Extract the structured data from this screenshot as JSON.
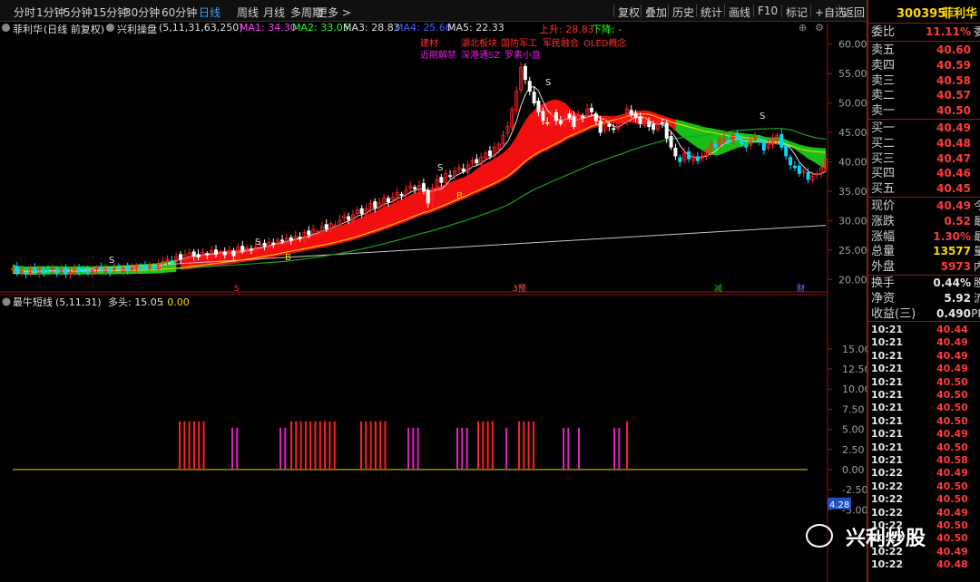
{
  "toolbar": {
    "periods": [
      "分时",
      "1分钟",
      "5分钟",
      "15分钟",
      "30分钟",
      "60分钟",
      "日线",
      "周线",
      "月线",
      "多周期",
      "更多 >"
    ],
    "active_period": "日线",
    "actions": [
      "复权",
      "叠加",
      "历史",
      "统计",
      "画线",
      "F10",
      "标记",
      "+自选",
      "返回"
    ]
  },
  "title": {
    "stock_name": "菲利华",
    "mode": "(日线 前复权)",
    "indicator": "兴利操盘",
    "params": "(5,11,31,63,250)",
    "ma1": "MA1: 34.30",
    "ma2": "MA2: 33.05",
    "ma3": "MA3: 28.83",
    "ma4": "MA4: 25.66",
    "ma5": "MA5: 22.33",
    "up_label": "上升: 28.83",
    "down_label": "下降: -"
  },
  "tags": {
    "line1": [
      "建材",
      "湖北板块",
      "国防军工",
      "军民融合",
      "OLED概念"
    ],
    "line2": [
      "近期解禁",
      "深港通SZ",
      "罗素小盘"
    ]
  },
  "lower": {
    "name": "最牛短线",
    "params": "(5,11,31)",
    "value_label": "多头: 15.05",
    "value2": ": 0.00",
    "current_readout": "4.28"
  },
  "event_markers": [
    "S",
    "3预",
    "减",
    "财"
  ],
  "panel": {
    "code": "300395",
    "name": "菲利华",
    "webi_label": "委比",
    "webi_value": "11.11%",
    "webi_tail": "委",
    "asks": [
      {
        "label": "卖五",
        "price": "40.60"
      },
      {
        "label": "卖四",
        "price": "40.59"
      },
      {
        "label": "卖三",
        "price": "40.58"
      },
      {
        "label": "卖二",
        "price": "40.57"
      },
      {
        "label": "卖一",
        "price": "40.50"
      }
    ],
    "bids": [
      {
        "label": "买一",
        "price": "40.49"
      },
      {
        "label": "买二",
        "price": "40.48"
      },
      {
        "label": "买三",
        "price": "40.47"
      },
      {
        "label": "买四",
        "price": "40.46"
      },
      {
        "label": "买五",
        "price": "40.45"
      }
    ],
    "stats": [
      {
        "label": "现价",
        "value": "40.49",
        "tail": "今",
        "color": "#ff3a3a"
      },
      {
        "label": "涨跌",
        "value": "0.52",
        "tail": "最",
        "color": "#ff3a3a"
      },
      {
        "label": "涨幅",
        "value": "1.30%",
        "tail": "最",
        "color": "#ff3a3a"
      },
      {
        "label": "总量",
        "value": "13577",
        "tail": "量",
        "color": "#ffd700"
      },
      {
        "label": "外盘",
        "value": "5973",
        "tail": "内",
        "color": "#ff3a3a"
      }
    ],
    "stats2": [
      {
        "label": "换手",
        "value": "0.44%",
        "tail": "股",
        "color": "#e8e8e8"
      },
      {
        "label": "净资",
        "value": "5.92",
        "tail": "流",
        "color": "#e8e8e8"
      },
      {
        "label": "收益(三)",
        "value": "0.490",
        "tail": "PE",
        "color": "#e8e8e8"
      }
    ],
    "trades": [
      {
        "time": "10:21",
        "price": "40.44"
      },
      {
        "time": "10:21",
        "price": "40.49"
      },
      {
        "time": "10:21",
        "price": "40.49"
      },
      {
        "time": "10:21",
        "price": "40.49"
      },
      {
        "time": "10:21",
        "price": "40.50"
      },
      {
        "time": "10:21",
        "price": "40.50"
      },
      {
        "time": "10:21",
        "price": "40.50"
      },
      {
        "time": "10:21",
        "price": "40.50"
      },
      {
        "time": "10:21",
        "price": "40.49"
      },
      {
        "time": "10:21",
        "price": "40.50"
      },
      {
        "time": "10:21",
        "price": "40.58"
      },
      {
        "time": "10:22",
        "price": "40.49"
      },
      {
        "time": "10:22",
        "price": "40.50"
      },
      {
        "time": "10:22",
        "price": "40.50"
      },
      {
        "time": "10:22",
        "price": "40.49"
      },
      {
        "time": "10:22",
        "price": "40.50"
      },
      {
        "time": "10:22",
        "price": "40.50"
      },
      {
        "time": "10:22",
        "price": "40.49"
      },
      {
        "time": "10:22",
        "price": "40.48"
      }
    ]
  },
  "watermark": "兴利炒股",
  "colors": {
    "up": "#ff2020",
    "down": "#00d8ff",
    "ma_green": "#20ff20",
    "ribbon_red": "#ff1010",
    "magenta": "#e020c0",
    "gold": "#d4c000",
    "blue_link": "#3f9eff"
  },
  "chart_data": [
    {
      "type": "candlestick",
      "title": "菲利华 (日线 前复权)",
      "y_ticks": [
        20.0,
        25.0,
        30.0,
        35.0,
        40.0,
        45.0,
        50.0,
        55.0,
        60.0
      ],
      "ylim": [
        18.5,
        61.5
      ],
      "close_series": [
        21.8,
        21.2,
        21.5,
        21.0,
        21.6,
        21.3,
        21.8,
        21.2,
        21.5,
        21.9,
        21.1,
        21.6,
        20.9,
        21.3,
        21.8,
        21.4,
        21.7,
        21.2,
        21.5,
        21.9,
        21.6,
        21.8,
        21.3,
        21.9,
        21.7,
        22.0,
        21.5,
        21.9,
        22.3,
        22.0,
        21.8,
        22.4,
        22.0,
        22.6,
        23.1,
        23.5,
        23.0,
        23.9,
        23.5,
        24.2,
        24.5,
        24.0,
        23.8,
        24.6,
        24.2,
        24.9,
        24.3,
        24.7,
        24.2,
        24.9,
        24.0,
        25.5,
        24.8,
        25.4,
        25.0,
        25.6,
        26.0,
        25.7,
        26.3,
        26.0,
        26.7,
        26.5,
        27.0,
        26.7,
        27.4,
        27.0,
        28.0,
        27.6,
        28.5,
        28.2,
        29.0,
        28.6,
        29.5,
        29.2,
        30.1,
        30.8,
        30.2,
        31.0,
        31.8,
        31.2,
        32.0,
        32.9,
        32.2,
        33.0,
        33.8,
        33.2,
        34.0,
        34.8,
        34.3,
        35.2,
        35.9,
        35.4,
        36.0,
        35.0,
        33.0,
        35.5,
        37.0,
        36.5,
        38.0,
        37.5,
        38.5,
        39.0,
        38.4,
        39.5,
        40.2,
        39.8,
        40.8,
        41.5,
        41.0,
        42.5,
        43.0,
        44.5,
        46.0,
        49.0,
        52.0,
        56.0,
        54.0,
        52.0,
        50.0,
        48.5,
        47.0,
        46.5,
        48.0,
        47.0,
        46.5,
        48.0,
        47.5,
        46.0,
        48.0,
        47.5,
        49.0,
        48.5,
        47.0,
        45.0,
        46.5,
        46.0,
        45.5,
        46.5,
        47.0,
        49.0,
        48.0,
        47.5,
        46.5,
        47.0,
        46.0,
        45.5,
        47.0,
        46.5,
        44.0,
        42.5,
        41.0,
        40.0,
        41.5,
        40.5,
        41.0,
        40.2,
        41.0,
        42.0,
        43.0,
        42.5,
        43.8,
        44.0,
        43.5,
        44.5,
        44.0,
        43.0,
        42.5,
        43.8,
        44.2,
        43.5,
        42.0,
        43.0,
        44.0,
        44.5,
        42.5,
        41.0,
        39.5,
        39.0,
        38.0,
        38.5,
        37.0,
        37.5,
        38.0,
        39.0,
        40.49
      ],
      "annotations": [
        "S",
        "B"
      ]
    },
    {
      "type": "bar",
      "title": "最牛短线 (5,11,31)",
      "y_ticks": [
        -5.0,
        -2.5,
        0.0,
        2.5,
        5.0,
        7.5,
        10.0,
        12.5,
        15.0
      ],
      "ylim": [
        -7.0,
        19.5
      ],
      "current_value": -4.28,
      "bar_groups": [
        {
          "color": "red",
          "count": 6,
          "value": 6.0
        },
        {
          "color": "magenta",
          "count": 2,
          "value": 5.2
        },
        {
          "color": "magenta",
          "count": 2,
          "value": 5.2
        },
        {
          "color": "red",
          "count": 10,
          "value": 6.0
        },
        {
          "color": "red",
          "count": 6,
          "value": 6.0
        },
        {
          "color": "magenta",
          "count": 3,
          "value": 5.2
        },
        {
          "color": "magenta",
          "count": 3,
          "value": 5.2
        },
        {
          "color": "red",
          "count": 4,
          "value": 6.0
        },
        {
          "color": "magenta",
          "count": 1,
          "value": 5.2
        },
        {
          "color": "red",
          "count": 4,
          "value": 6.0
        },
        {
          "color": "magenta",
          "count": 2,
          "value": 5.2
        },
        {
          "color": "magenta",
          "count": 1,
          "value": 5.2
        },
        {
          "color": "magenta",
          "count": 2,
          "value": 5.2
        },
        {
          "color": "red",
          "count": 1,
          "value": 6.0
        }
      ]
    }
  ]
}
